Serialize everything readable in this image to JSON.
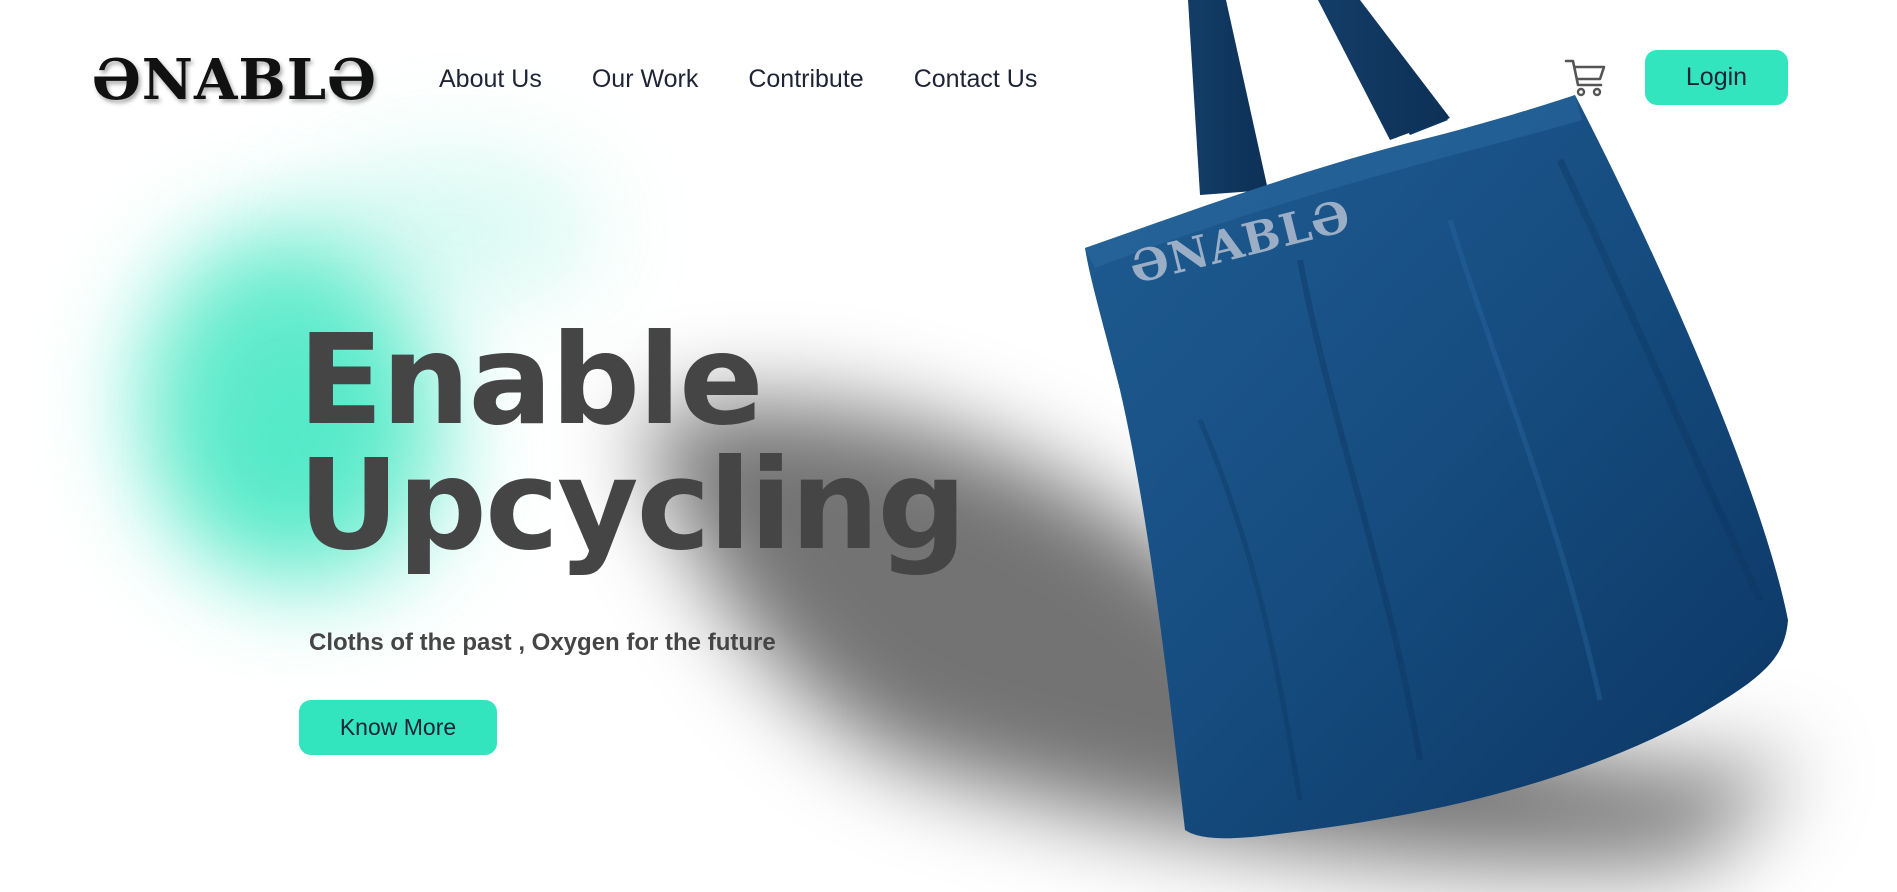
{
  "header": {
    "logo_text": "ƏNABLƏ",
    "nav": [
      "About Us",
      "Our Work",
      "Contribute",
      "Contact Us"
    ],
    "cart_icon": "shopping-cart-icon",
    "login_label": "Login"
  },
  "hero": {
    "headline_line1": "Enable",
    "headline_line2": "Upcycling",
    "tagline": "Cloths of the past , Oxygen for the future",
    "cta_label": "Know More",
    "bag_logo_text": "ƏNABLƏ"
  },
  "colors": {
    "accent": "#33e5bf",
    "headline": "#454545",
    "nav_text": "#1e2436",
    "bag_blue": "#15497a"
  }
}
